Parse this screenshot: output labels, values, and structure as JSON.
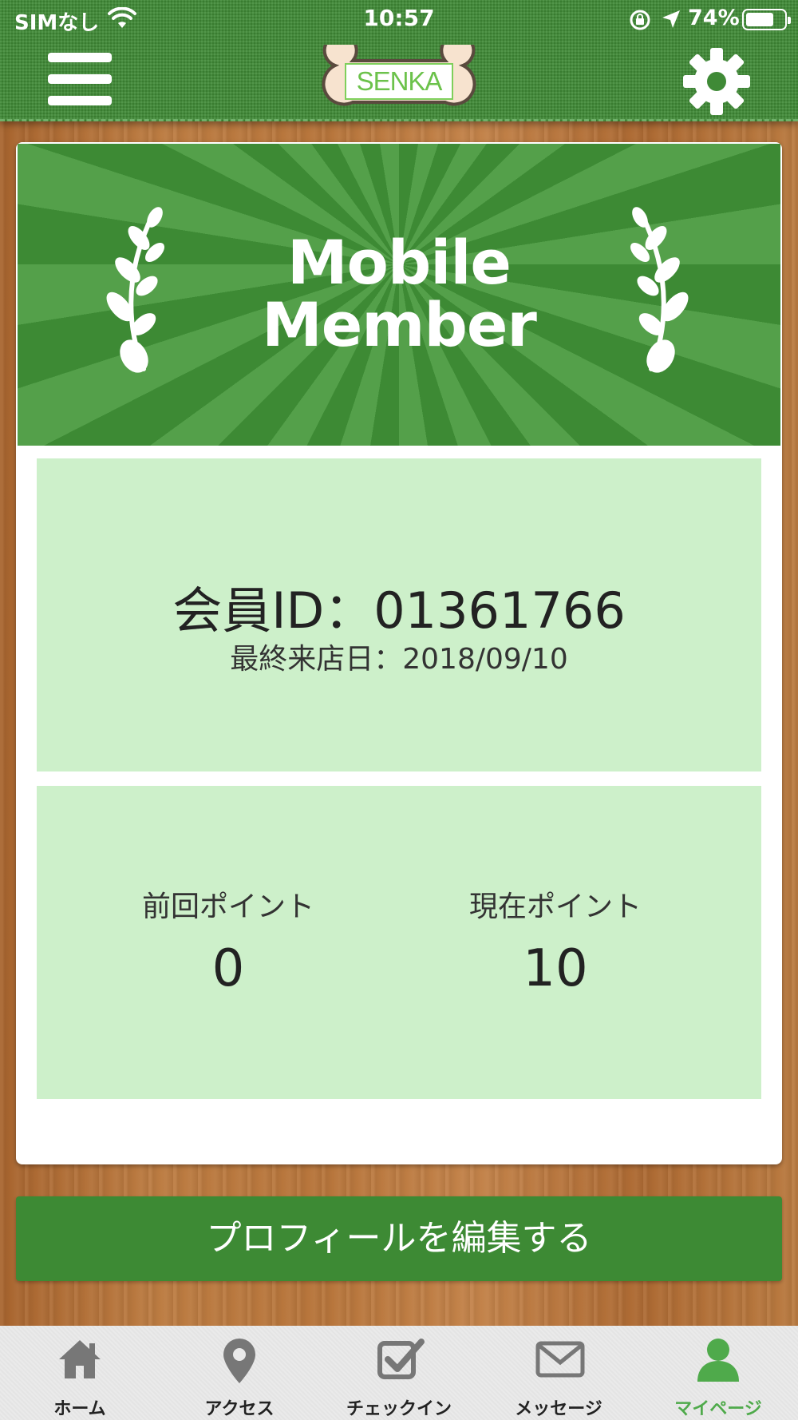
{
  "status_bar": {
    "carrier": "SIMなし",
    "time": "10:57",
    "battery": "74%"
  },
  "header": {
    "logo_text": "SENKA"
  },
  "banner": {
    "title_line1": "Mobile",
    "title_line2": "Member"
  },
  "member": {
    "id_text": "会員ID：01361766",
    "last_visit_text": "最終来店日：2018/09/10"
  },
  "points": {
    "previous_label": "前回ポイント",
    "previous_value": "0",
    "current_label": "現在ポイント",
    "current_value": "10"
  },
  "edit_button_label": "プロフィールを編集する",
  "tabs": [
    {
      "label": "ホーム",
      "icon": "home-icon"
    },
    {
      "label": "アクセス",
      "icon": "map-pin-icon"
    },
    {
      "label": "チェックイン",
      "icon": "checkbox-icon"
    },
    {
      "label": "メッセージ",
      "icon": "envelope-icon"
    },
    {
      "label": "マイページ",
      "icon": "person-icon"
    }
  ],
  "colors": {
    "header_green": "#3f8a36",
    "panel_green": "#cdf0ca",
    "button_green": "#3d8a34",
    "active_tab": "#4faa4b"
  }
}
